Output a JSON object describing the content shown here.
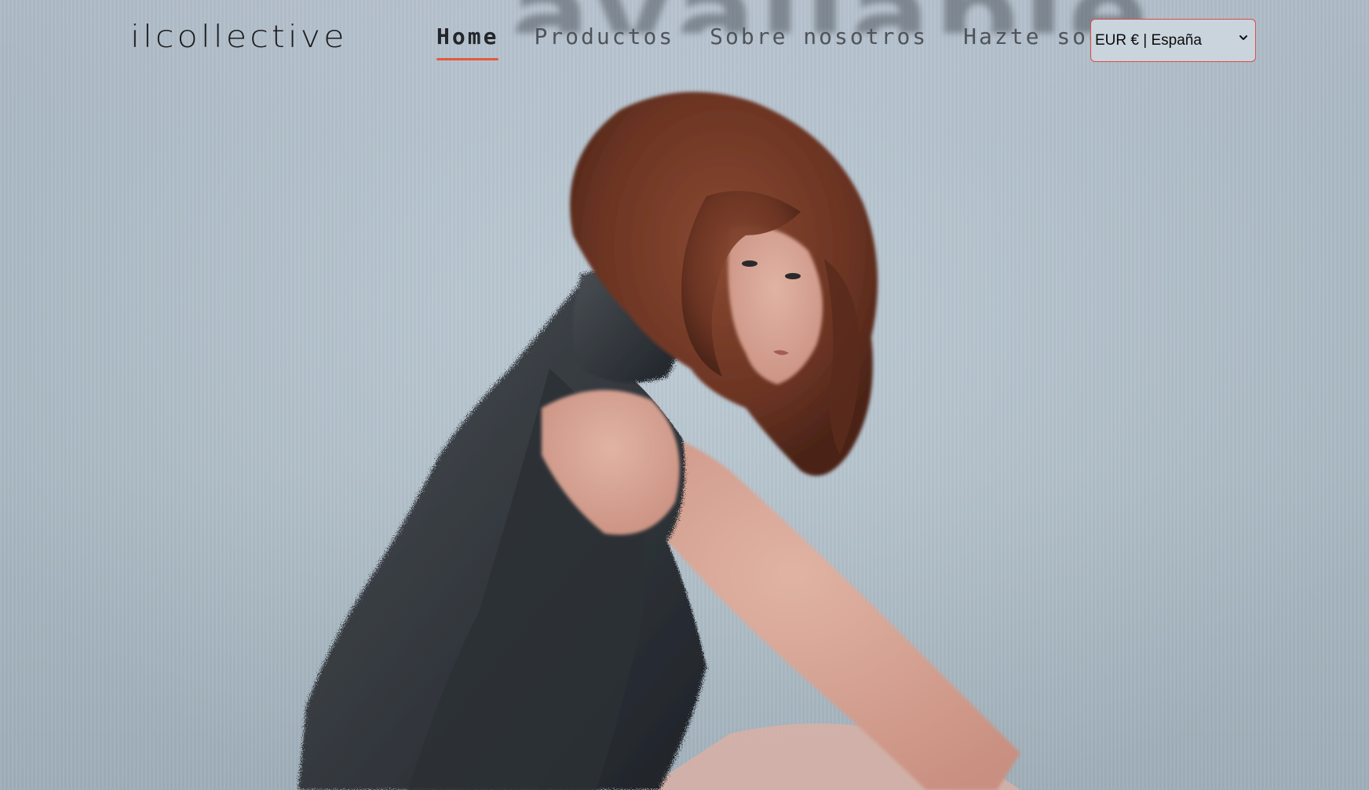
{
  "brand": {
    "logo_text": "ilcollective"
  },
  "nav": {
    "items": [
      {
        "label": "Home",
        "active": true
      },
      {
        "label": "Productos",
        "active": false
      },
      {
        "label": "Sobre nosotros",
        "active": false
      },
      {
        "label": "Hazte socio",
        "active": false
      }
    ]
  },
  "locale": {
    "selected": "EUR € | España",
    "options": [
      "EUR € | España"
    ]
  },
  "colors": {
    "accent": "#e35b3c",
    "select_border": "#d94e45",
    "background": "#b3c3cf"
  },
  "icons": {
    "select_arrow": "chevron-down-icon"
  }
}
